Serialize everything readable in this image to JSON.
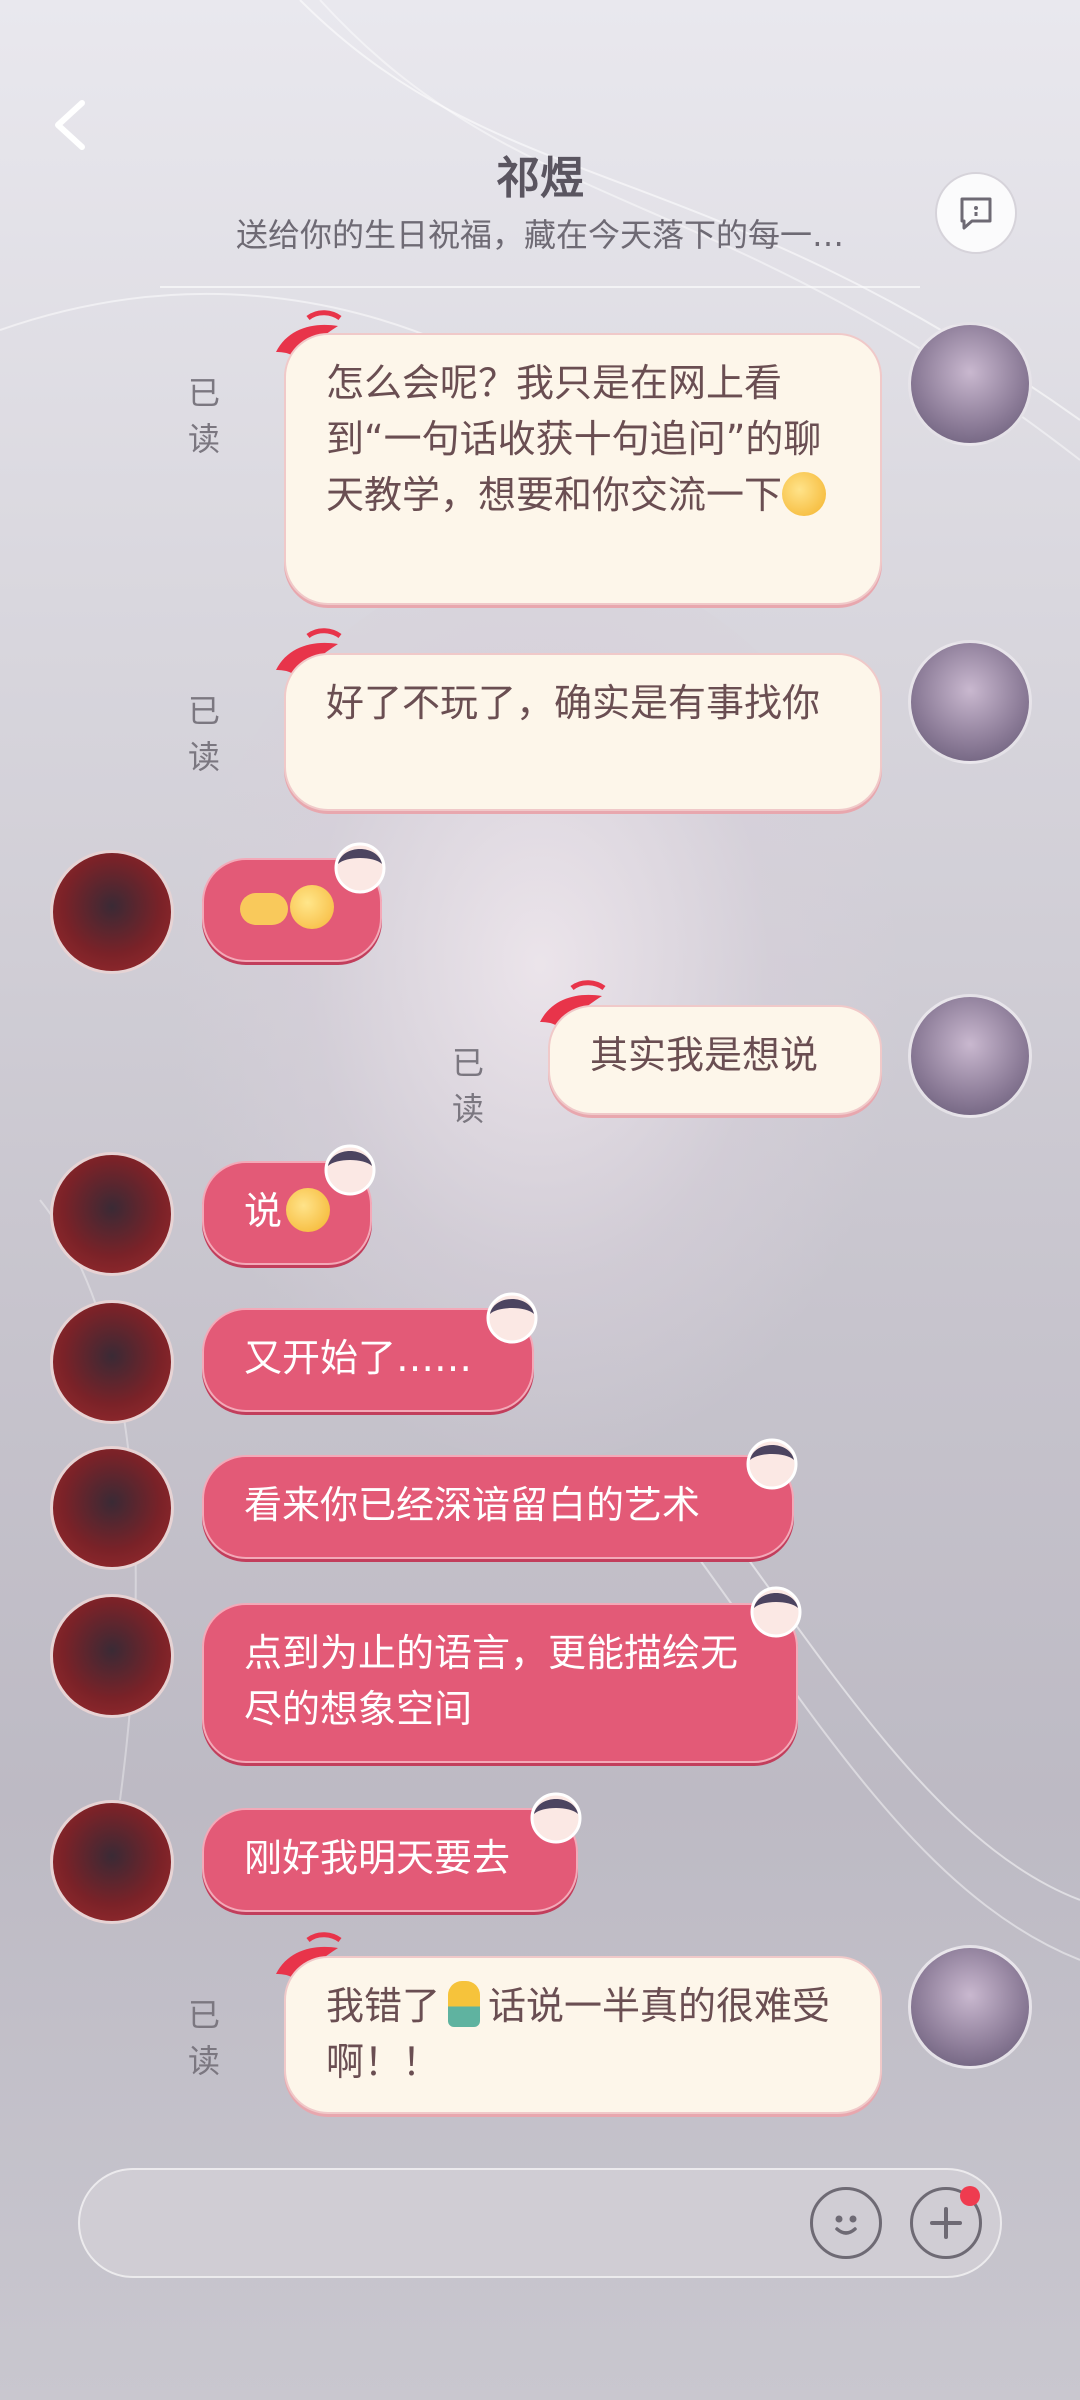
{
  "header": {
    "title": "祁煜",
    "subtitle": "送给你的生日祝福，藏在今天落下的每一…"
  },
  "read_label": "已读",
  "messages": [
    {
      "from": "me",
      "text": "怎么会呢？我只是在网上看到“一句话收获十句追问”的聊天教学，想要和你交流一下",
      "emoji": "cool-sunglasses-emoji",
      "read": true
    },
    {
      "from": "me",
      "text": "好了不玩了，确实是有事找你",
      "read": true
    },
    {
      "from": "other",
      "text": "",
      "emoji": "hand-and-tongue-emoji"
    },
    {
      "from": "me",
      "text": "其实我是想说",
      "read": true
    },
    {
      "from": "other",
      "text": "说",
      "emoji": "eating-emoji"
    },
    {
      "from": "other",
      "text": "又开始了……"
    },
    {
      "from": "other",
      "text": "看来你已经深谙留白的艺术"
    },
    {
      "from": "other",
      "text": "点到为止的语言，更能描绘无尽的想象空间"
    },
    {
      "from": "other",
      "text": "刚好我明天要去"
    },
    {
      "from": "me",
      "text_a": "我错了",
      "text_b": "话说一半真的很难受啊！！",
      "emoji": "person-emoji",
      "read": true
    }
  ],
  "input": {
    "placeholder": ""
  },
  "colors": {
    "incoming": "#e35a77",
    "outgoing": "#fdf6ea",
    "badge": "#ef3b4f"
  }
}
